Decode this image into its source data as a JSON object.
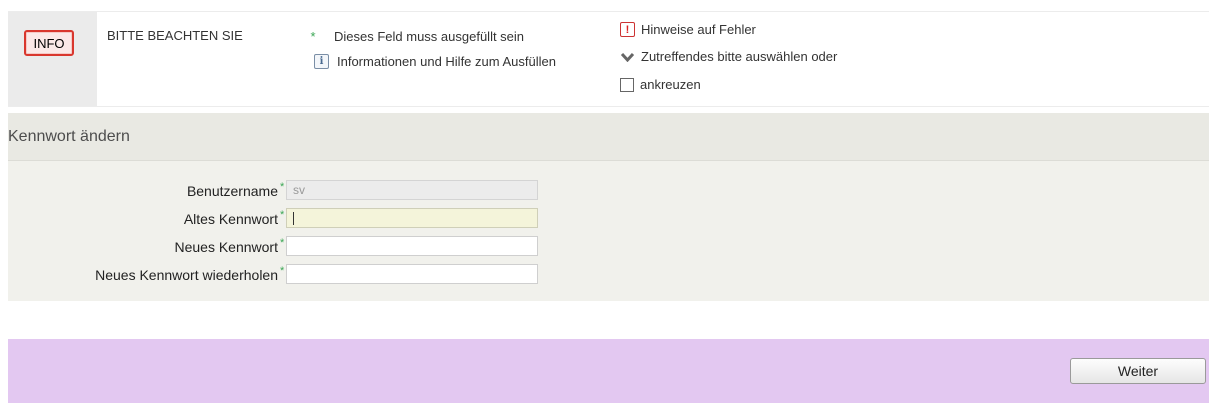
{
  "info": {
    "badge": "INFO",
    "title": "BITTE BEACHTEN SIE",
    "legend": {
      "required": "Dieses Feld muss ausgefüllt sein",
      "help": "Informationen und Hilfe zum Ausfüllen",
      "error": "Hinweise auf Fehler",
      "select": "Zutreffendes bitte auswählen oder",
      "checkbox": "ankreuzen"
    }
  },
  "form": {
    "title": "Kennwort ändern",
    "fields": [
      {
        "label": "Benutzername",
        "value": "sv",
        "state": "disabled"
      },
      {
        "label": "Altes Kennwort",
        "value": "",
        "state": "focused"
      },
      {
        "label": "Neues Kennwort",
        "value": "",
        "state": "normal"
      },
      {
        "label": "Neues Kennwort wiederholen",
        "value": "",
        "state": "normal"
      }
    ],
    "required_mark": "*"
  },
  "actions": {
    "next_label": "Weiter"
  },
  "colors": {
    "required_star": "#3aa654",
    "error_red": "#d9372e",
    "bottom_bar": "#e3c8f1",
    "panel_bg": "#f1f1ec"
  }
}
